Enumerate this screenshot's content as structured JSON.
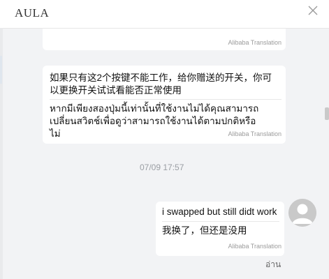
{
  "header": {
    "title": "AULA",
    "close_icon": "close-icon"
  },
  "messages": [
    {
      "direction": "incoming",
      "original": "",
      "translation": "",
      "translation_source": "Alibaba Translation"
    },
    {
      "direction": "incoming",
      "original": "如果只有这2个按键不能工作，给你赠送的开关，你可以更换开关试试看能否正常使用",
      "translation": "หากมีเพียงสองปุ่มนี้เท่านั้นที่ใช้งานไม่ได้คุณสามารถเปลี่ยนสวิตช์เพื่อดูว่าสามารถใช้งานได้ตามปกติหรือไม่",
      "translation_source": "Alibaba Translation"
    },
    {
      "direction": "outgoing",
      "original": "i swapped but still didt work",
      "translation": "我换了，但还是没用",
      "translation_source": "Alibaba Translation"
    }
  ],
  "timestamp": "07/09 17:57",
  "read_status": "อ่าน",
  "colors": {
    "background": "#f2f3f5",
    "bubble": "#ffffff",
    "avatar": "#c8c8c8",
    "muted_text": "#9b9b9b"
  }
}
